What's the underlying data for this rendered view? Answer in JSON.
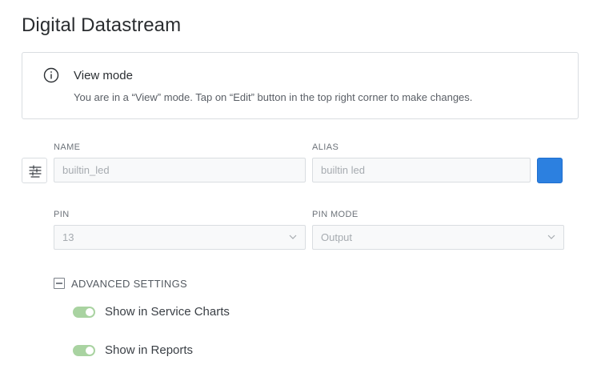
{
  "page": {
    "title": "Digital Datastream"
  },
  "notice": {
    "icon": "info-icon",
    "title": "View mode",
    "text": "You are in a “View” mode. Tap on “Edit” button in the top right corner to make changes."
  },
  "fields": {
    "name": {
      "label": "NAME",
      "value": "builtin_led"
    },
    "alias": {
      "label": "ALIAS",
      "value": "builtin led"
    },
    "color": {
      "value": "#2c80e0"
    },
    "pin": {
      "label": "PIN",
      "value": "13"
    },
    "pin_mode": {
      "label": "PIN MODE",
      "value": "Output"
    }
  },
  "advanced": {
    "label": "ADVANCED SETTINGS",
    "toggles": [
      {
        "label": "Show in Service Charts",
        "on": true
      },
      {
        "label": "Show in Reports",
        "on": true
      }
    ]
  },
  "colors": {
    "toggle_on": "#a9d3a1",
    "accent": "#2c80e0"
  }
}
